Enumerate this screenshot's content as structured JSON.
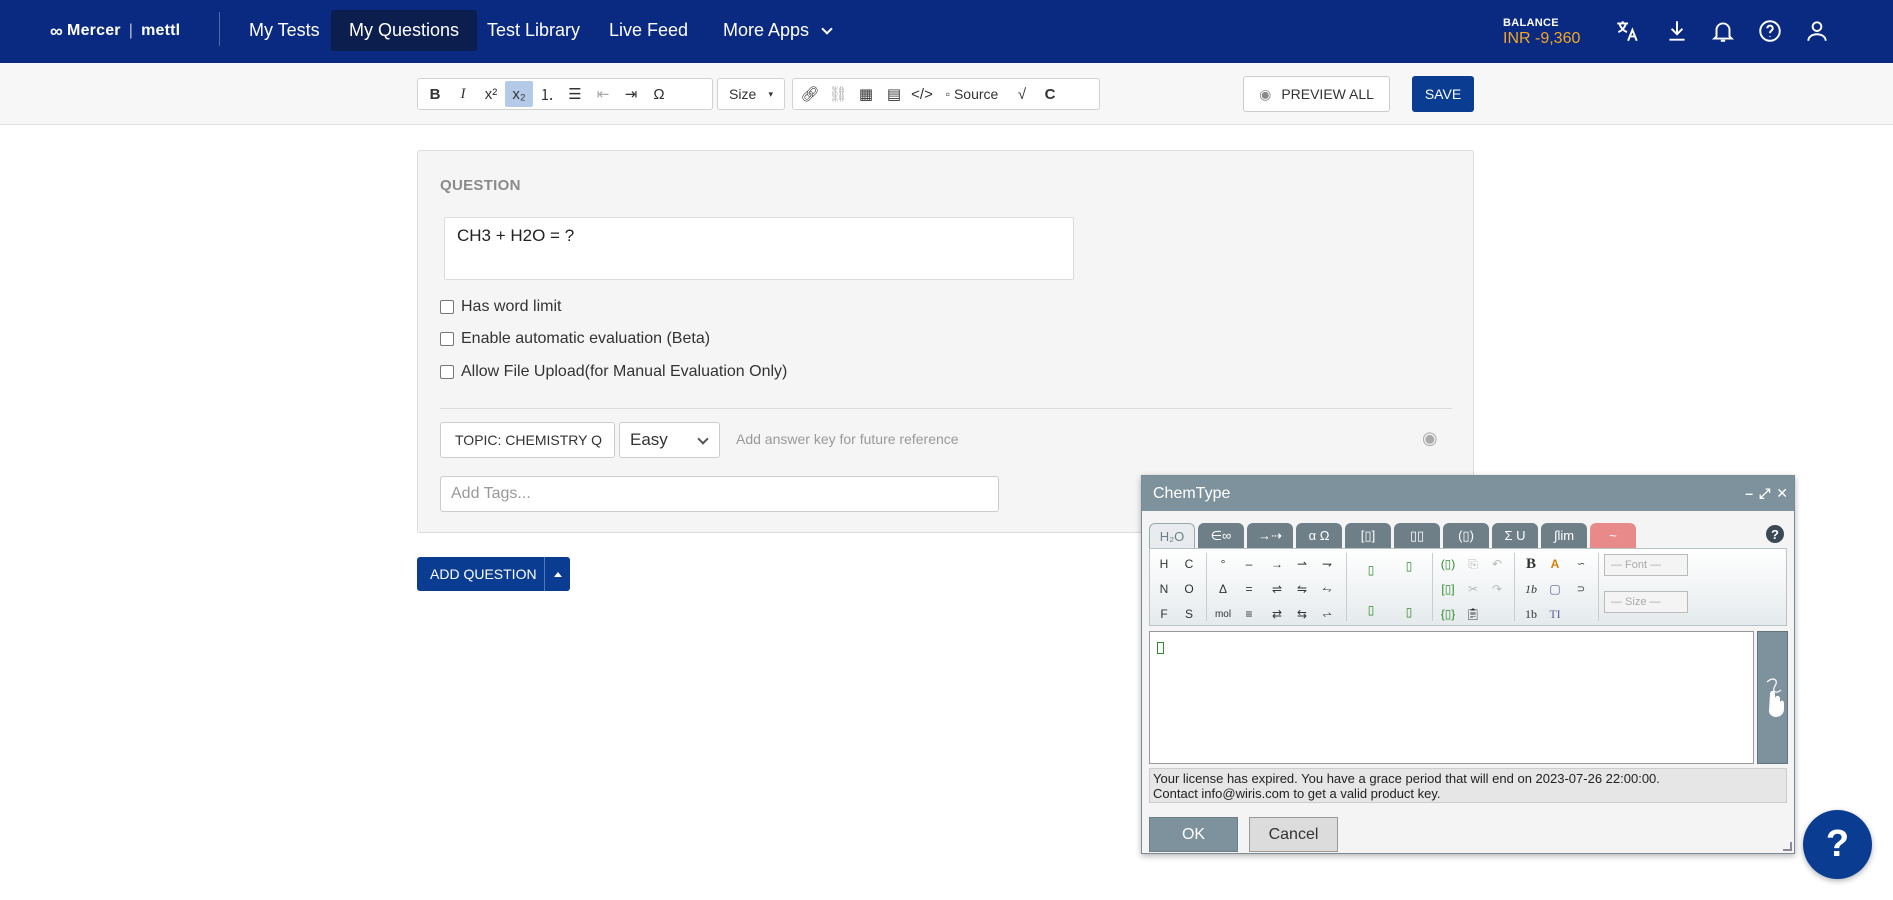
{
  "nav": {
    "brand_left": "Mercer",
    "brand_sep": "|",
    "brand_right": "mettl",
    "items": [
      {
        "label": "My Tests"
      },
      {
        "label": "My Questions",
        "active": true
      },
      {
        "label": "Test Library"
      },
      {
        "label": "Live Feed"
      },
      {
        "label": "More Apps"
      }
    ],
    "balance_label": "BALANCE",
    "balance_value": "INR -9,360",
    "icons": [
      "translate-icon",
      "download-icon",
      "bell-icon",
      "help-icon",
      "user-icon"
    ],
    "accent_color": "#0a2a82",
    "balance_color": "#f5a623"
  },
  "toolbar": {
    "size_label": "Size",
    "source_label": "Source",
    "preview_label": "PREVIEW ALL",
    "save_label": "SAVE"
  },
  "question": {
    "section_title": "QUESTION",
    "text": "CH3  +  H2O  = ?",
    "checkboxes": [
      {
        "label": "Has word limit",
        "checked": false
      },
      {
        "label": "Enable automatic evaluation (Beta)",
        "checked": false
      },
      {
        "label": "Allow File Upload(for Manual Evaluation Only)",
        "checked": false
      }
    ],
    "topic": "TOPIC:  CHEMISTRY Q",
    "difficulty": "Easy",
    "answer_key_link": "Add answer key for future reference",
    "tags_placeholder": "Add Tags..."
  },
  "add_question_label": "ADD QUESTION",
  "chemtype": {
    "title": "ChemType",
    "tabs": [
      "H₂O",
      "∈∞",
      "→⇢",
      "α Ω",
      "[▯]",
      "▯▯",
      "(▯)",
      "Σ U",
      "∫lim",
      "~"
    ],
    "palette": {
      "elements": [
        "H",
        "C",
        "N",
        "O",
        "F",
        "S"
      ],
      "symbols": [
        "°",
        "–",
        "Δ",
        "=",
        "mol",
        "≡"
      ],
      "font_placeholder": "— Font —",
      "size_placeholder": "— Size —"
    },
    "license_msg_line1": "Your license has expired. You have a grace period that will end on 2023-07-26 22:00:00.",
    "license_msg_line2": "Contact info@wiris.com to get a valid product key.",
    "ok_label": "OK",
    "cancel_label": "Cancel"
  },
  "help_fab_label": "?"
}
